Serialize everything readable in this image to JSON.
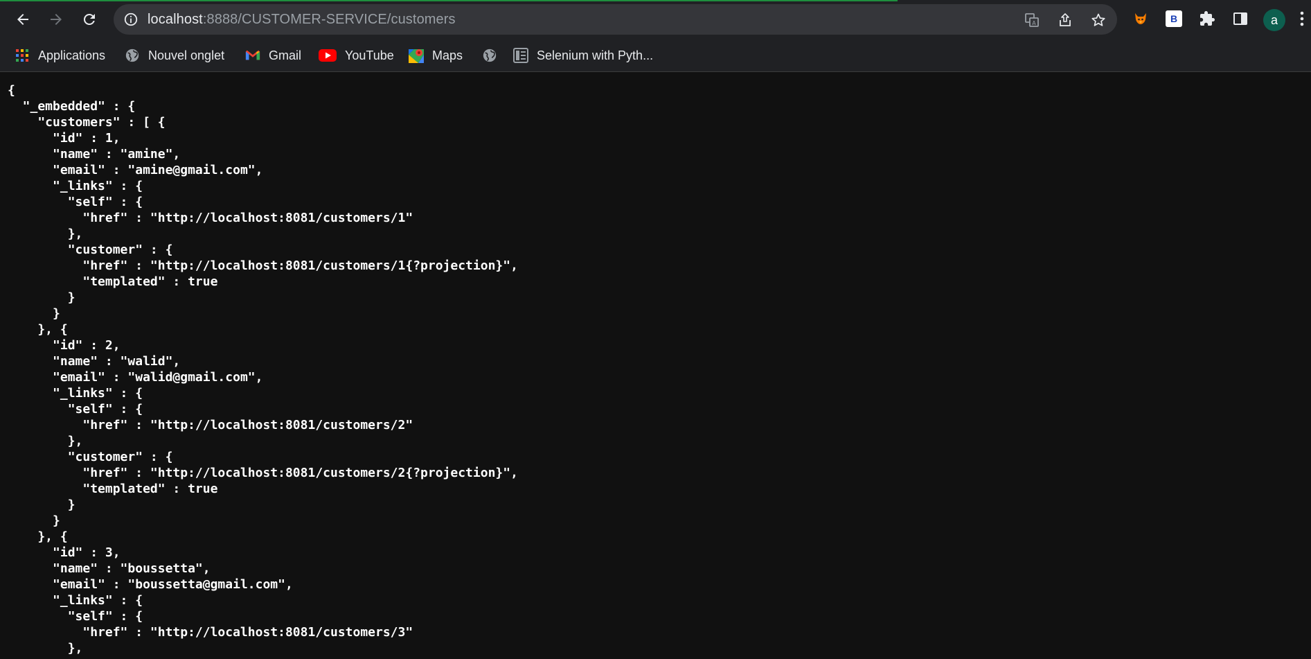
{
  "browser": {
    "url_host": "localhost",
    "url_rest": ":8888/CUSTOMER-SERVICE/customers",
    "profile_initial": "a",
    "extension_label": "B"
  },
  "bookmarks": [
    {
      "label": "Applications",
      "icon": "apps-grid-icon"
    },
    {
      "label": "Nouvel onglet",
      "icon": "globe-icon"
    },
    {
      "label": "Gmail",
      "icon": "gmail-icon"
    },
    {
      "label": "YouTube",
      "icon": "youtube-icon"
    },
    {
      "label": "Maps",
      "icon": "maps-icon"
    },
    {
      "label": "",
      "icon": "globe-icon"
    },
    {
      "label": "Selenium with Pyth...",
      "icon": "document-icon"
    }
  ],
  "json_lines": [
    "{",
    "  \"_embedded\" : {",
    "    \"customers\" : [ {",
    "      \"id\" : 1,",
    "      \"name\" : \"amine\",",
    "      \"email\" : \"amine@gmail.com\",",
    "      \"_links\" : {",
    "        \"self\" : {",
    "          \"href\" : \"http://localhost:8081/customers/1\"",
    "        },",
    "        \"customer\" : {",
    "          \"href\" : \"http://localhost:8081/customers/1{?projection}\",",
    "          \"templated\" : true",
    "        }",
    "      }",
    "    }, {",
    "      \"id\" : 2,",
    "      \"name\" : \"walid\",",
    "      \"email\" : \"walid@gmail.com\",",
    "      \"_links\" : {",
    "        \"self\" : {",
    "          \"href\" : \"http://localhost:8081/customers/2\"",
    "        },",
    "        \"customer\" : {",
    "          \"href\" : \"http://localhost:8081/customers/2{?projection}\",",
    "          \"templated\" : true",
    "        }",
    "      }",
    "    }, {",
    "      \"id\" : 3,",
    "      \"name\" : \"boussetta\",",
    "      \"email\" : \"boussetta@gmail.com\",",
    "      \"_links\" : {",
    "        \"self\" : {",
    "          \"href\" : \"http://localhost:8081/customers/3\"",
    "        },"
  ]
}
